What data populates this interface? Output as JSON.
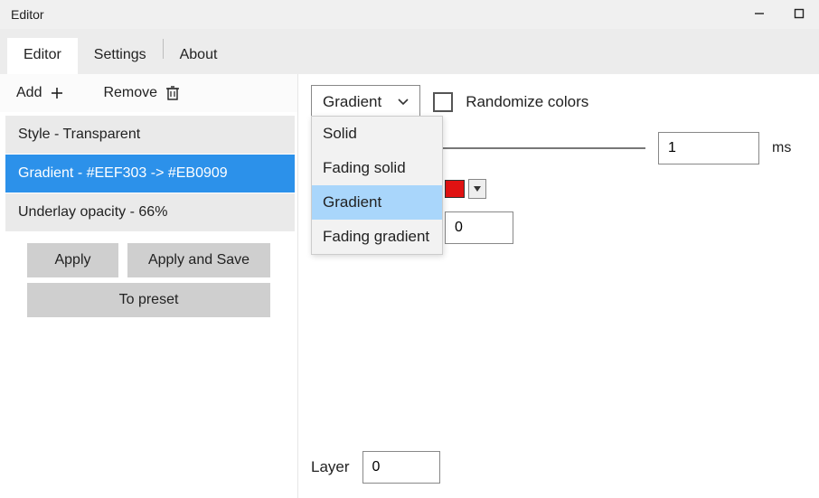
{
  "window": {
    "title": "Editor"
  },
  "tabs": [
    {
      "label": "Editor",
      "active": true
    },
    {
      "label": "Settings",
      "active": false
    },
    {
      "label": "About",
      "active": false
    }
  ],
  "left": {
    "add_label": "Add",
    "remove_label": "Remove",
    "items": [
      {
        "label": "Style - Transparent",
        "selected": false
      },
      {
        "label": "Gradient - #EEF303 -> #EB0909",
        "selected": true
      },
      {
        "label": "Underlay opacity - 66%",
        "selected": false
      }
    ],
    "apply_label": "Apply",
    "apply_save_label": "Apply and Save",
    "to_preset_label": "To preset"
  },
  "right": {
    "type_selected": "Gradient",
    "type_options": [
      "Solid",
      "Fading solid",
      "Gradient",
      "Fading gradient"
    ],
    "type_highlight_index": 2,
    "randomize_label": "Randomize colors",
    "randomize_checked": false,
    "duration_value": "1",
    "duration_unit": "ms",
    "color_hex": "#e01212",
    "number_value": "0",
    "layer_label": "Layer",
    "layer_value": "0"
  }
}
